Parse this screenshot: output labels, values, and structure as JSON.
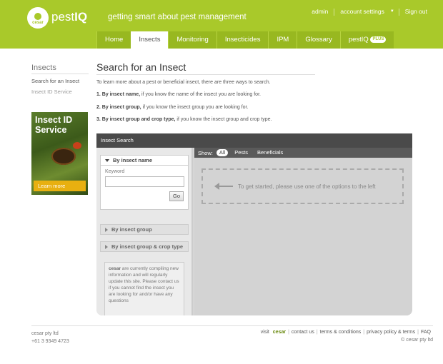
{
  "header": {
    "logo_sub": "cesar",
    "brand_prefix": "pest",
    "brand_bold": "IQ",
    "tagline": "getting smart about pest management",
    "top_links": [
      "admin",
      "account settings",
      "Sign out"
    ]
  },
  "nav": {
    "items": [
      "Home",
      "Insects",
      "Monitoring",
      "Insecticides",
      "IPM",
      "Glossary",
      "pestIQ"
    ],
    "plus_badge": "PLUS",
    "active": "Insects"
  },
  "sidebar": {
    "title": "Insects",
    "links": [
      "Search for an Insect",
      "Insect ID Service"
    ],
    "promo_title": "Insect ID Service",
    "promo_button": "Learn more"
  },
  "main": {
    "title": "Search for an Insect",
    "intro": "To learn more about a pest or beneficial insect, there are three ways to search.",
    "steps": [
      {
        "bold": "1. By insect name,",
        "text": " if you know the name of the insect you are looking for."
      },
      {
        "bold": "2. By insect group,",
        "text": " if you know the insect group you are looking for."
      },
      {
        "bold": "3. By insect group and crop type,",
        "text": " if you know the insect group and crop type."
      }
    ]
  },
  "search": {
    "panel_title": "Insect Search",
    "by_name": "By insect name",
    "keyword_label": "Keyword",
    "keyword_value": "",
    "go": "Go",
    "by_group": "By insect group",
    "by_group_crop": "By insect group & crop type",
    "note_bold": "cesar",
    "note_text": " are currently compiling new information and will regularly update this site. Please contact us if you cannot find the insect you are looking for and/or have any questions",
    "show_label": "Show:",
    "filters": [
      "All",
      "Pests",
      "Beneficials"
    ],
    "active_filter": "All",
    "placeholder": "To get started, please use one of the options to the left"
  },
  "footer": {
    "company": "cesar pty ltd",
    "phone": "+61 3 9349 4723",
    "visit_prefix": "visit",
    "visit_brand": "cesar",
    "links": [
      "contact us",
      "terms & conditions",
      "privacy policy & terms",
      "FAQ"
    ],
    "copyright": "© cesar pty ltd"
  }
}
